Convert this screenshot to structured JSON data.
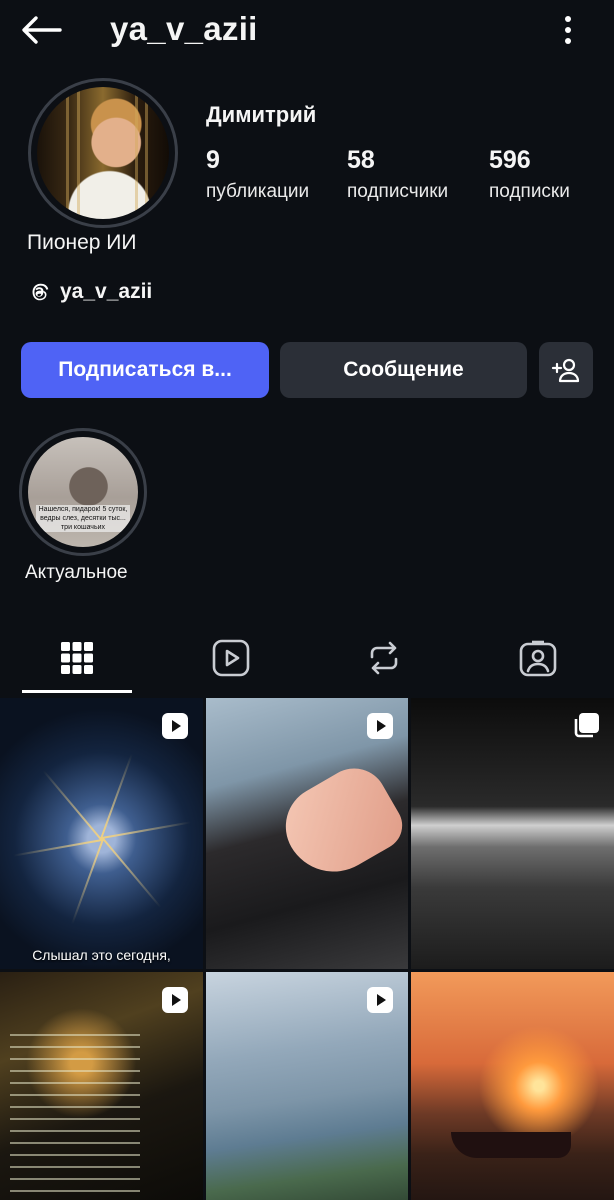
{
  "header": {
    "username": "ya_v_azii"
  },
  "profile": {
    "display_name": "Димитрий",
    "bio": "Пионер ИИ",
    "threads_handle": "ya_v_azii",
    "stats": {
      "posts": {
        "value": "9",
        "label": "публикации"
      },
      "followers": {
        "value": "58",
        "label": "подписчики"
      },
      "following": {
        "value": "596",
        "label": "подписки"
      }
    }
  },
  "actions": {
    "follow_label": "Подписаться в...",
    "message_label": "Сообщение"
  },
  "highlights": [
    {
      "label": "Актуальное",
      "image_text": "Нашелся, пидарок! 5 суток, ведры слез, десятки тыс... три кошачьих"
    }
  ],
  "tabs": [
    {
      "name": "grid",
      "icon": "grid-icon",
      "active": true
    },
    {
      "name": "reels",
      "icon": "reels-icon",
      "active": false
    },
    {
      "name": "reposts",
      "icon": "repost-icon",
      "active": false
    },
    {
      "name": "tagged",
      "icon": "tagged-icon",
      "active": false
    }
  ],
  "posts": [
    {
      "type": "reel",
      "caption": "Слышал это сегодня,"
    },
    {
      "type": "reel",
      "caption": ""
    },
    {
      "type": "carousel",
      "caption": ""
    },
    {
      "type": "reel",
      "caption": ""
    },
    {
      "type": "reel",
      "caption": ""
    },
    {
      "type": "image",
      "caption": ""
    }
  ],
  "colors": {
    "background": "#0c0f14",
    "accent": "#4f63f5",
    "secondary_button": "#2b2f37"
  }
}
